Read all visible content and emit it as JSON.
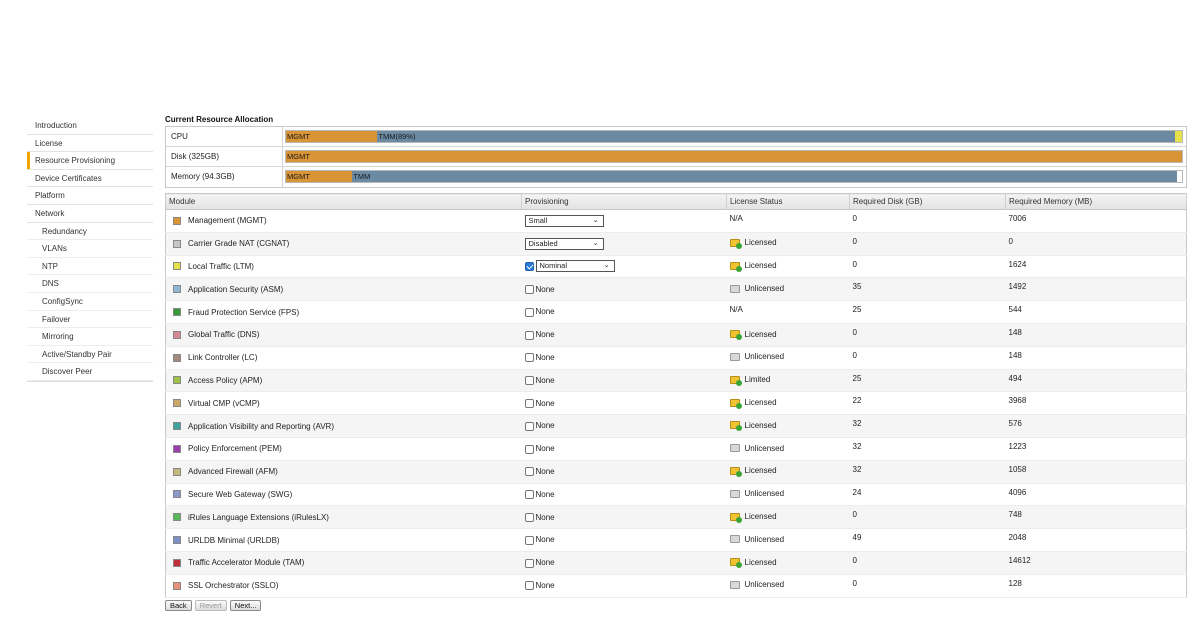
{
  "sidebar": {
    "items": [
      {
        "label": "Introduction"
      },
      {
        "label": "License"
      },
      {
        "label": "Resource Provisioning"
      },
      {
        "label": "Device Certificates"
      },
      {
        "label": "Platform"
      },
      {
        "label": "Network"
      },
      {
        "label": "Redundancy"
      },
      {
        "label": "VLANs"
      },
      {
        "label": "NTP"
      },
      {
        "label": "DNS"
      },
      {
        "label": "ConfigSync"
      },
      {
        "label": "Failover"
      },
      {
        "label": "Mirroring"
      },
      {
        "label": "Active/Standby Pair"
      },
      {
        "label": "Discover Peer"
      }
    ],
    "active_index": 2
  },
  "allocation": {
    "title": "Current Resource Allocation",
    "rows": [
      {
        "label": "CPU",
        "segments": [
          {
            "label": "MGMT",
            "fraction": 0.102,
            "color": "#d99436"
          },
          {
            "label": "TMM(89%)",
            "fraction": 0.89,
            "color": "#6b8aa3"
          },
          {
            "label": "",
            "fraction": 0.008,
            "color": "#e6e04a"
          }
        ]
      },
      {
        "label": "Disk (325GB)",
        "segments": [
          {
            "label": "MGMT",
            "fraction": 1.0,
            "color": "#d99436"
          }
        ]
      },
      {
        "label": "Memory (94.3GB)",
        "segments": [
          {
            "label": "MGMT",
            "fraction": 0.074,
            "color": "#d99436"
          },
          {
            "label": "TMM",
            "fraction": 0.92,
            "color": "#6b8aa3"
          }
        ]
      }
    ]
  },
  "table": {
    "headers": {
      "module": "Module",
      "provisioning": "Provisioning",
      "license": "License Status",
      "disk": "Required Disk (GB)",
      "memory": "Required Memory (MB)"
    },
    "rows": [
      {
        "module": "Management (MGMT)",
        "color": "#d99436",
        "prov_type": "select",
        "prov": "Small",
        "license": "N/A",
        "lic_icon": "",
        "disk": "0",
        "memory": "7006"
      },
      {
        "module": "Carrier Grade NAT (CGNAT)",
        "color": "#c7c7c7",
        "prov_type": "select",
        "prov": "Disabled",
        "license": "Licensed",
        "lic_icon": "ok",
        "disk": "0",
        "memory": "0"
      },
      {
        "module": "Local Traffic (LTM)",
        "color": "#e6e04a",
        "prov_type": "check-select",
        "prov": "Nominal",
        "license": "Licensed",
        "lic_icon": "ok",
        "disk": "0",
        "memory": "1624"
      },
      {
        "module": "Application Security (ASM)",
        "color": "#8fb8d6",
        "prov_type": "check",
        "prov": "None",
        "license": "Unlicensed",
        "lic_icon": "no",
        "disk": "35",
        "memory": "1492"
      },
      {
        "module": "Fraud Protection Service (FPS)",
        "color": "#3a9a3a",
        "prov_type": "check",
        "prov": "None",
        "license": "N/A",
        "lic_icon": "",
        "disk": "25",
        "memory": "544"
      },
      {
        "module": "Global Traffic (DNS)",
        "color": "#d48a94",
        "prov_type": "check",
        "prov": "None",
        "license": "Licensed",
        "lic_icon": "ok",
        "disk": "0",
        "memory": "148"
      },
      {
        "module": "Link Controller (LC)",
        "color": "#a38b7c",
        "prov_type": "check",
        "prov": "None",
        "license": "Unlicensed",
        "lic_icon": "no",
        "disk": "0",
        "memory": "148"
      },
      {
        "module": "Access Policy (APM)",
        "color": "#9fc047",
        "prov_type": "check",
        "prov": "None",
        "license": "Limited",
        "lic_icon": "ok",
        "disk": "25",
        "memory": "494"
      },
      {
        "module": "Virtual CMP (vCMP)",
        "color": "#c9a86a",
        "prov_type": "check",
        "prov": "None",
        "license": "Licensed",
        "lic_icon": "ok",
        "disk": "22",
        "memory": "3968"
      },
      {
        "module": "Application Visibility and Reporting (AVR)",
        "color": "#3fa3a0",
        "prov_type": "check",
        "prov": "None",
        "license": "Licensed",
        "lic_icon": "ok",
        "disk": "32",
        "memory": "576"
      },
      {
        "module": "Policy Enforcement (PEM)",
        "color": "#9a3fb0",
        "prov_type": "check",
        "prov": "None",
        "license": "Unlicensed",
        "lic_icon": "no",
        "disk": "32",
        "memory": "1223"
      },
      {
        "module": "Advanced Firewall (AFM)",
        "color": "#c3b87a",
        "prov_type": "check",
        "prov": "None",
        "license": "Licensed",
        "lic_icon": "ok",
        "disk": "32",
        "memory": "1058"
      },
      {
        "module": "Secure Web Gateway (SWG)",
        "color": "#8d99c9",
        "prov_type": "check",
        "prov": "None",
        "license": "Unlicensed",
        "lic_icon": "no",
        "disk": "24",
        "memory": "4096"
      },
      {
        "module": "iRules Language Extensions (iRulesLX)",
        "color": "#57b857",
        "prov_type": "check",
        "prov": "None",
        "license": "Licensed",
        "lic_icon": "ok",
        "disk": "0",
        "memory": "748"
      },
      {
        "module": "URLDB Minimal (URLDB)",
        "color": "#7f8fc7",
        "prov_type": "check",
        "prov": "None",
        "license": "Unlicensed",
        "lic_icon": "no",
        "disk": "49",
        "memory": "2048"
      },
      {
        "module": "Traffic Accelerator Module (TAM)",
        "color": "#c0303a",
        "prov_type": "check",
        "prov": "None",
        "license": "Licensed",
        "lic_icon": "ok",
        "disk": "0",
        "memory": "14612"
      },
      {
        "module": "SSL Orchestrator (SSLO)",
        "color": "#e8907a",
        "prov_type": "check",
        "prov": "None",
        "license": "Unlicensed",
        "lic_icon": "no",
        "disk": "0",
        "memory": "128"
      }
    ]
  },
  "buttons": {
    "back": "Back",
    "revert": "Revert",
    "next": "Next..."
  }
}
